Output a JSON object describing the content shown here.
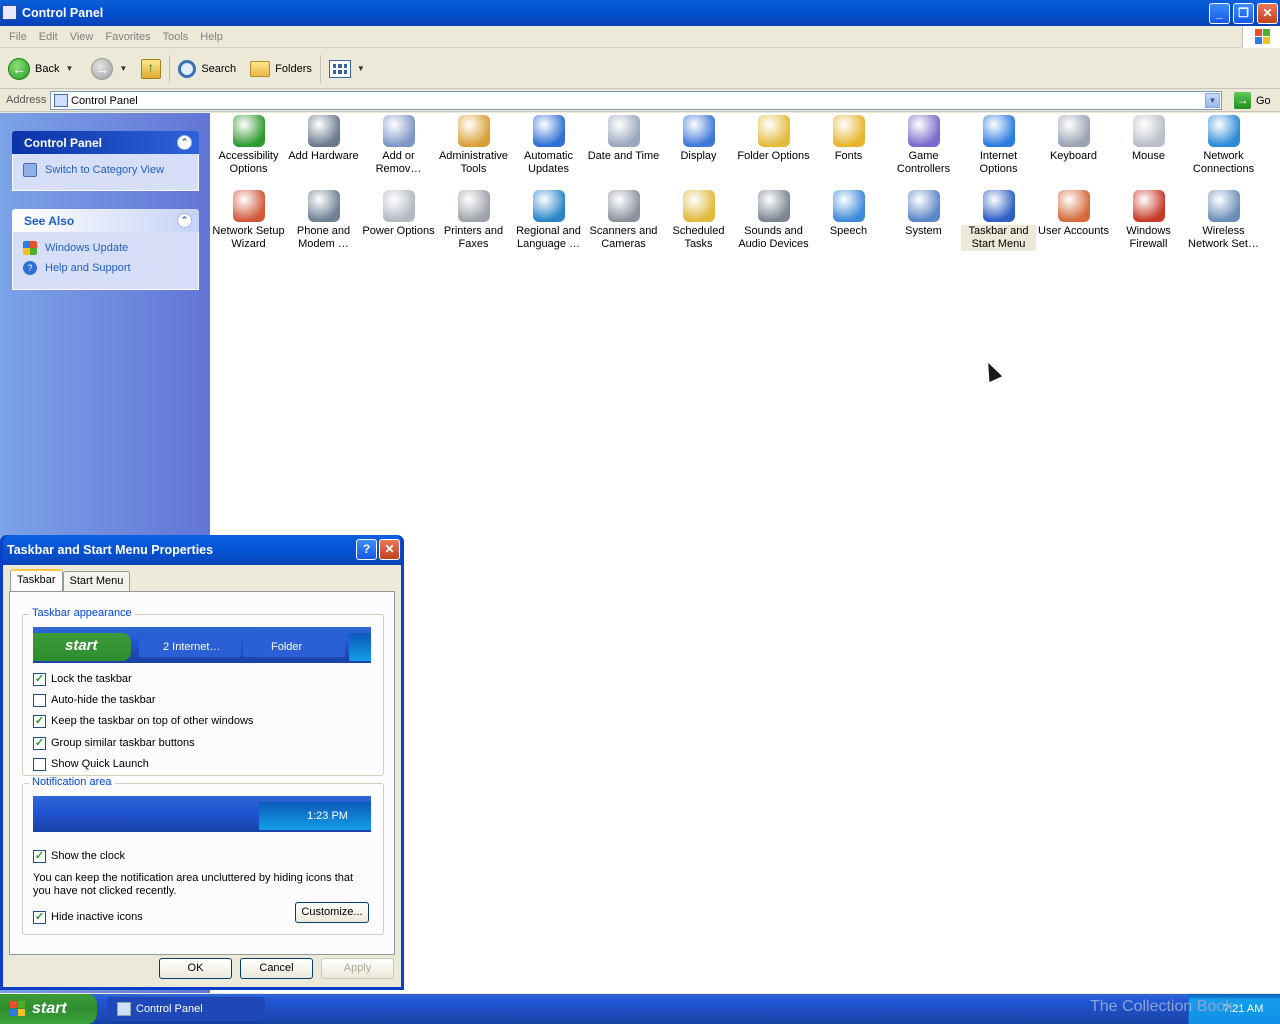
{
  "window": {
    "title": "Control Panel"
  },
  "menu": [
    "File",
    "Edit",
    "View",
    "Favorites",
    "Tools",
    "Help"
  ],
  "toolbar": {
    "back": "Back",
    "search": "Search",
    "folders": "Folders"
  },
  "address": {
    "label": "Address",
    "value": "Control Panel",
    "go": "Go"
  },
  "sidebar": {
    "control_panel": {
      "title": "Control Panel",
      "link": "Switch to Category View"
    },
    "see_also": {
      "title": "See Also",
      "links": [
        "Windows Update",
        "Help and Support"
      ]
    }
  },
  "items": [
    {
      "label": "Accessibility Options",
      "color": "#2f9a2f"
    },
    {
      "label": "Add Hardware",
      "color": "#6a7a8c"
    },
    {
      "label": "Add or Remov…",
      "color": "#7e96c7"
    },
    {
      "label": "Administrative Tools",
      "color": "#d9a036"
    },
    {
      "label": "Automatic Updates",
      "color": "#2f6fd6"
    },
    {
      "label": "Date and Time",
      "color": "#9aa7bd"
    },
    {
      "label": "Display",
      "color": "#3e78d8"
    },
    {
      "label": "Folder Options",
      "color": "#e3bb3c"
    },
    {
      "label": "Fonts",
      "color": "#e6b42e"
    },
    {
      "label": "Game Controllers",
      "color": "#7a6acb"
    },
    {
      "label": "Internet Options",
      "color": "#2a7be0"
    },
    {
      "label": "Keyboard",
      "color": "#9aa2b4"
    },
    {
      "label": "Mouse",
      "color": "#b9bec9"
    },
    {
      "label": "Network Connections",
      "color": "#2c8bd6"
    },
    {
      "label": "Network Setup Wizard",
      "color": "#d2583a"
    },
    {
      "label": "Phone and Modem …",
      "color": "#6f7f94"
    },
    {
      "label": "Power Options",
      "color": "#b3b8c2"
    },
    {
      "label": "Printers and Faxes",
      "color": "#9ea3ab"
    },
    {
      "label": "Regional and Language …",
      "color": "#2a86c8"
    },
    {
      "label": "Scanners and Cameras",
      "color": "#8c939e"
    },
    {
      "label": "Scheduled Tasks",
      "color": "#e1b93d"
    },
    {
      "label": "Sounds and Audio Devices",
      "color": "#7d8593"
    },
    {
      "label": "Speech",
      "color": "#3d8ad9"
    },
    {
      "label": "System",
      "color": "#5b86c8"
    },
    {
      "label": "Taskbar and Start Menu",
      "color": "#2d5fc4"
    },
    {
      "label": "User Accounts",
      "color": "#d46a3a"
    },
    {
      "label": "Windows Firewall",
      "color": "#c63a2a"
    },
    {
      "label": "Wireless Network Set…",
      "color": "#6b8fb8"
    }
  ],
  "dialog": {
    "title": "Taskbar and Start Menu Properties",
    "tabs": [
      "Taskbar",
      "Start Menu"
    ],
    "appearance": {
      "title": "Taskbar appearance",
      "preview": {
        "start": "start",
        "btn1": "2 Internet…",
        "btn2": "Folder"
      },
      "options": [
        {
          "label": "Lock the taskbar",
          "checked": true
        },
        {
          "label": "Auto-hide the taskbar",
          "checked": false
        },
        {
          "label": "Keep the taskbar on top of other windows",
          "checked": true
        },
        {
          "label": "Group similar taskbar buttons",
          "checked": true
        },
        {
          "label": "Show Quick Launch",
          "checked": false
        }
      ]
    },
    "notification": {
      "title": "Notification area",
      "preview_time": "1:23 PM",
      "show_clock": "Show the clock",
      "desc": "You can keep the notification area uncluttered by hiding icons that you have not clicked recently.",
      "hide_inactive": "Hide inactive icons",
      "customize": "Customize..."
    },
    "buttons": {
      "ok": "OK",
      "cancel": "Cancel",
      "apply": "Apply"
    }
  },
  "taskbar": {
    "start": "start",
    "task": "Control Panel",
    "time": "7:21 AM",
    "watermark": "The Collection Book"
  }
}
